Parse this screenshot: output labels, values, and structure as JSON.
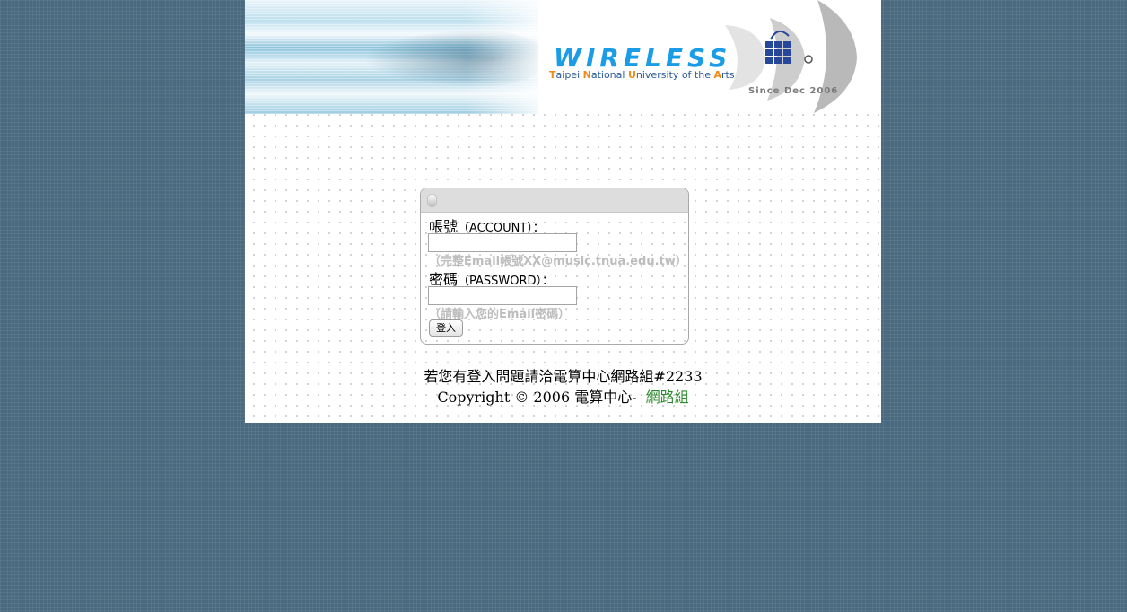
{
  "banner": {
    "logo_word": "WIRELESS",
    "logo_sub": {
      "part1_cap": "T",
      "part1": "aipei ",
      "part2_cap": "N",
      "part2": "ational ",
      "part3_cap": "U",
      "part3": "niversity of the ",
      "part4_cap": "A",
      "part4": "rts"
    },
    "since": "Since Dec 2006"
  },
  "login": {
    "account_label": "帳號",
    "account_label_en": "（ACCOUNT）：",
    "account_value": "",
    "account_hint": "（完整Email帳號XX@music.tnua.edu.tw）",
    "password_label": "密碼",
    "password_label_en": "（PASSWORD）：",
    "password_value": "",
    "password_hint": "（請輸入您的Email密碼）",
    "submit_label": "登入"
  },
  "footer": {
    "note": "若您有登入問題請洽電算中心網路組#2233",
    "copyright": "Copyright © 2006 電算中心-",
    "link": "網路組"
  },
  "colors": {
    "background": "#4a6a80",
    "logo_blue": "#1a9de6",
    "logo_orange": "#f28a16",
    "link_green": "#2a8a2a"
  }
}
